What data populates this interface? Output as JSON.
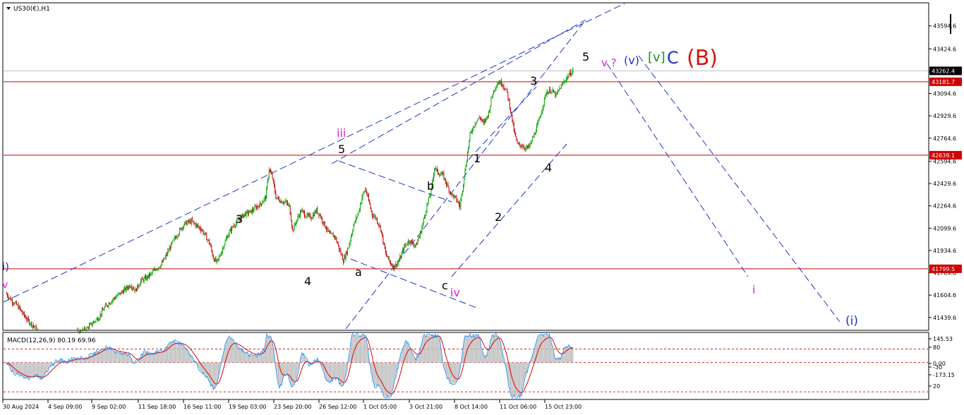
{
  "symbol": "US30(€),H1",
  "macd_label": "MACD(12,26,9) 80.19 69.96",
  "colors": {
    "bull": "#00a000",
    "bear": "#c00000",
    "level_line": "#d00000",
    "channel": "#1a35c8",
    "magenta": "#e020e0",
    "navy": "#1a35c8",
    "green": "#1f8f1f",
    "red": "#e01010",
    "macd_hist": "#c0c0c0",
    "macd_main": "#1e90ff",
    "macd_signal": "#e00000"
  },
  "chart_data": {
    "type": "candlestick",
    "timeframe": "H1",
    "ylim": [
      41350,
      43760
    ],
    "y_ticks": [
      "43594.6",
      "43424.6",
      "43254.6",
      "43094.6",
      "42929.6",
      "42764.6",
      "42594.6",
      "42429.6",
      "42264.6",
      "42099.6",
      "41934.6",
      "41769.6",
      "41604.6",
      "41439.6"
    ],
    "x_ticks": [
      "30 Aug 2024",
      "4 Sep 09:00",
      "9 Sep 02:00",
      "11 Sep 18:00",
      "16 Sep 11:00",
      "19 Sep 03:00",
      "23 Sep 20:00",
      "26 Sep 12:00",
      "1 Oct 05:00",
      "3 Oct 21:00",
      "8 Oct 14:00",
      "11 Oct 06:00",
      "15 Oct 23:00"
    ],
    "price_path": [
      [
        0,
        41620
      ],
      [
        4,
        41590
      ],
      [
        8,
        41560
      ],
      [
        12,
        41540
      ],
      [
        16,
        41510
      ],
      [
        20,
        41470
      ],
      [
        26,
        41420
      ],
      [
        34,
        41370
      ],
      [
        40,
        41320
      ],
      [
        44,
        41280
      ],
      [
        52,
        41280
      ],
      [
        58,
        41270
      ],
      [
        62,
        41300
      ],
      [
        70,
        41290
      ],
      [
        80,
        41320
      ],
      [
        90,
        41340
      ],
      [
        95,
        41350
      ],
      [
        100,
        41380
      ],
      [
        110,
        41440
      ],
      [
        118,
        41520
      ],
      [
        128,
        41580
      ],
      [
        136,
        41620
      ],
      [
        142,
        41650
      ],
      [
        148,
        41680
      ],
      [
        154,
        41640
      ],
      [
        160,
        41710
      ],
      [
        166,
        41730
      ],
      [
        172,
        41760
      ],
      [
        178,
        41800
      ],
      [
        184,
        41830
      ],
      [
        188,
        41870
      ],
      [
        194,
        41950
      ],
      [
        200,
        42020
      ],
      [
        206,
        42080
      ],
      [
        210,
        42120
      ],
      [
        214,
        42140
      ],
      [
        220,
        42150
      ],
      [
        226,
        42120
      ],
      [
        232,
        42090
      ],
      [
        236,
        42050
      ],
      [
        242,
        41980
      ],
      [
        246,
        41880
      ],
      [
        250,
        41845
      ],
      [
        254,
        41900
      ],
      [
        258,
        41970
      ],
      [
        264,
        42060
      ],
      [
        270,
        42120
      ],
      [
        276,
        42160
      ],
      [
        282,
        42200
      ],
      [
        290,
        42220
      ],
      [
        296,
        42250
      ],
      [
        302,
        42280
      ],
      [
        308,
        42330
      ],
      [
        312,
        42540
      ],
      [
        316,
        42470
      ],
      [
        320,
        42330
      ],
      [
        326,
        42300
      ],
      [
        332,
        42290
      ],
      [
        336,
        42260
      ],
      [
        340,
        42080
      ],
      [
        344,
        42150
      ],
      [
        350,
        42230
      ],
      [
        356,
        42190
      ],
      [
        362,
        42180
      ],
      [
        368,
        42230
      ],
      [
        372,
        42200
      ],
      [
        378,
        42120
      ],
      [
        384,
        42050
      ],
      [
        390,
        42040
      ],
      [
        396,
        41930
      ],
      [
        400,
        41860
      ],
      [
        406,
        41960
      ],
      [
        412,
        42120
      ],
      [
        418,
        42220
      ],
      [
        422,
        42330
      ],
      [
        426,
        42390
      ],
      [
        430,
        42300
      ],
      [
        434,
        42200
      ],
      [
        438,
        42180
      ],
      [
        444,
        42100
      ],
      [
        450,
        41910
      ],
      [
        456,
        41840
      ],
      [
        460,
        41810
      ],
      [
        466,
        41860
      ],
      [
        472,
        41960
      ],
      [
        478,
        42010
      ],
      [
        486,
        41970
      ],
      [
        492,
        42080
      ],
      [
        498,
        42240
      ],
      [
        504,
        42380
      ],
      [
        508,
        42550
      ],
      [
        512,
        42510
      ],
      [
        518,
        42490
      ],
      [
        524,
        42400
      ],
      [
        528,
        42350
      ],
      [
        534,
        42310
      ],
      [
        538,
        42260
      ],
      [
        544,
        42520
      ],
      [
        550,
        42790
      ],
      [
        556,
        42880
      ],
      [
        562,
        42920
      ],
      [
        566,
        42870
      ],
      [
        572,
        42950
      ],
      [
        576,
        43080
      ],
      [
        580,
        43150
      ],
      [
        584,
        43180
      ],
      [
        588,
        43170
      ],
      [
        594,
        43100
      ],
      [
        598,
        42970
      ],
      [
        602,
        42820
      ],
      [
        606,
        42720
      ],
      [
        612,
        42710
      ],
      [
        616,
        42690
      ],
      [
        620,
        42700
      ],
      [
        626,
        42790
      ],
      [
        632,
        42900
      ],
      [
        636,
        43000
      ],
      [
        640,
        43100
      ],
      [
        646,
        43120
      ],
      [
        652,
        43080
      ],
      [
        656,
        43130
      ],
      [
        662,
        43190
      ],
      [
        668,
        43240
      ],
      [
        672,
        43262
      ]
    ],
    "levels": [
      {
        "label": "43262.4",
        "price": 43262.4,
        "kind": "current"
      },
      {
        "label": "43181.7",
        "price": 43181.7,
        "kind": "resistance"
      },
      {
        "label": "42639.1",
        "price": 42639.1,
        "kind": "resistance"
      },
      {
        "label": "41799.5",
        "price": 41799.5,
        "kind": "support"
      }
    ],
    "wave_labels": [
      {
        "t": "i)",
        "c": "navy"
      },
      {
        "t": "v",
        "c": "magenta"
      },
      {
        "t": "3",
        "c": "black"
      },
      {
        "t": "4",
        "c": "black"
      },
      {
        "t": "iii",
        "c": "magenta"
      },
      {
        "t": "5",
        "c": "black"
      },
      {
        "t": "a",
        "c": "black"
      },
      {
        "t": "b",
        "c": "black"
      },
      {
        "t": "c",
        "c": "black"
      },
      {
        "t": "iv",
        "c": "magenta"
      },
      {
        "t": "1",
        "c": "black"
      },
      {
        "t": "2",
        "c": "black"
      },
      {
        "t": "3",
        "c": "black"
      },
      {
        "t": "4",
        "c": "black"
      },
      {
        "t": "5",
        "c": "black"
      },
      {
        "t": "v ?",
        "c": "magenta"
      },
      {
        "t": "(v)",
        "c": "navy"
      },
      {
        "t": "[v]",
        "c": "green"
      },
      {
        "t": "C",
        "c": "navy"
      },
      {
        "t": "(B)",
        "c": "red"
      },
      {
        "t": "i",
        "c": "magenta"
      },
      {
        "t": "(i)",
        "c": "navy"
      }
    ],
    "macd": {
      "name": "MACD(12,26,9)",
      "main": 80.19,
      "signal": 69.96,
      "ylim": [
        -210,
        170
      ],
      "y_ticks": [
        "145.53",
        "80",
        "0.00",
        "-30",
        "-173.15",
        "20"
      ],
      "levels": [
        80,
        0,
        -173.15
      ]
    }
  }
}
